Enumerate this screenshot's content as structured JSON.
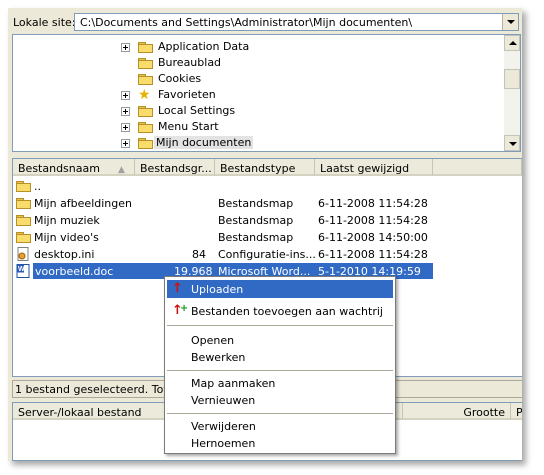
{
  "address": {
    "label": "Lokale site:",
    "path": "C:\\Documents and Settings\\Administrator\\Mijn documenten\\"
  },
  "tree": {
    "items": [
      {
        "label": "Application Data",
        "icon": "folder-icon",
        "expand": true
      },
      {
        "label": "Bureaublad",
        "icon": "folder-icon",
        "expand": false
      },
      {
        "label": "Cookies",
        "icon": "folder-icon",
        "expand": false
      },
      {
        "label": "Favorieten",
        "icon": "star-icon",
        "expand": true
      },
      {
        "label": "Local Settings",
        "icon": "folder-icon",
        "expand": true
      },
      {
        "label": "Menu Start",
        "icon": "folder-icon",
        "expand": true
      },
      {
        "label": "Mijn documenten",
        "icon": "folder-icon",
        "expand": true,
        "selected": true
      }
    ]
  },
  "files": {
    "columns": [
      "Bestandsnaam",
      "Bestandsgr...",
      "Bestandstype",
      "Laatst gewijzigd"
    ],
    "rows": [
      {
        "name": "..",
        "size": "",
        "type": "",
        "modified": "",
        "icon": "folder-icon"
      },
      {
        "name": "Mijn afbeeldingen",
        "size": "",
        "type": "Bestandsmap",
        "modified": "6-11-2008 11:54:28",
        "icon": "pictures-folder-icon"
      },
      {
        "name": "Mijn muziek",
        "size": "",
        "type": "Bestandsmap",
        "modified": "6-11-2008 11:54:28",
        "icon": "music-folder-icon"
      },
      {
        "name": "Mijn video's",
        "size": "",
        "type": "Bestandsmap",
        "modified": "6-11-2008 14:50:00",
        "icon": "video-folder-icon"
      },
      {
        "name": "desktop.ini",
        "size": "84",
        "type": "Configuratie-ins...",
        "modified": "6-11-2008 11:54:28",
        "icon": "ini-file-icon"
      },
      {
        "name": "voorbeeld.doc",
        "size": "19.968",
        "type": "Microsoft Word...",
        "modified": "5-1-2010 14:19:59",
        "icon": "word-doc-icon",
        "selected": true
      }
    ]
  },
  "status": {
    "text": "1 bestand geselecteerd. Totale"
  },
  "queue": {
    "columns": [
      "Server-/lokaal bestand",
      "Grootte",
      "P"
    ]
  },
  "context_menu": {
    "items": [
      {
        "label": "Uploaden",
        "icon": "upload-arrow-icon"
      },
      {
        "label": "Bestanden toevoegen aan wachtrij",
        "icon": "add-to-queue-icon"
      },
      {
        "label": "Openen"
      },
      {
        "label": "Bewerken"
      },
      {
        "label": "Map aanmaken"
      },
      {
        "label": "Vernieuwen"
      },
      {
        "label": "Verwijderen"
      },
      {
        "label": "Hernoemen"
      }
    ]
  },
  "colors": {
    "selection": "#316ac5",
    "border": "#7f9db9",
    "chrome": "#ece9d8"
  }
}
